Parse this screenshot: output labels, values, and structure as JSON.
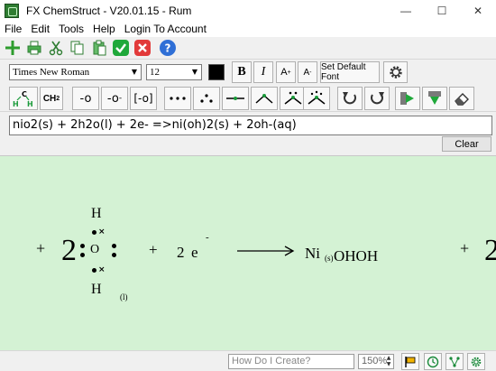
{
  "window": {
    "title": "FX ChemStruct - V20.01.15 - Rum",
    "minimize_glyph": "—",
    "maximize_glyph": "☐",
    "close_glyph": "✕"
  },
  "menu": [
    "File",
    "Edit",
    "Tools",
    "Help",
    "Login To Account"
  ],
  "font_toolbar": {
    "font_name": "Times New Roman",
    "font_size": "12",
    "color": "#000000",
    "bold_label": "B",
    "italic_label": "I",
    "superscript_label": "A",
    "subscript_label": "A",
    "default_font_label": "Set Default Font"
  },
  "chem_toolbar": {
    "hydrogen_label": "H",
    "ch2_label": "CH",
    "ch2_sub": "2",
    "bond_minus_label": "-o",
    "charge_minus_label": "-o",
    "charge_minus_sup": "-",
    "bracket_label": "[-o]"
  },
  "equation": {
    "text": "nio2(s) + 2h2o(l) + 2e- =>ni(oh)2(s) + 2oh-(aq)",
    "clear_label": "Clear"
  },
  "canvas": {
    "plus_1": "+",
    "coef_water": "2",
    "atom_h_top": "H",
    "atom_o": "O",
    "atom_h_bottom": "H",
    "state_water": "(l)",
    "plus_2": "+",
    "coef_electron": "2",
    "electron": "e",
    "electron_charge": "-",
    "product_ni": "Ni",
    "product_state": "(s)",
    "product_rest": "OHOH",
    "plus_3": "+",
    "coef_hydroxide": "2"
  },
  "statusbar": {
    "help_placeholder": "How Do I Create?",
    "zoom": "150%"
  },
  "colors": {
    "canvas_bg": "#d4f2d4",
    "new_icon": "#2e9d2e",
    "accept": "#1fa83a",
    "cancel": "#e23a3a",
    "help": "#2f6fd6"
  }
}
